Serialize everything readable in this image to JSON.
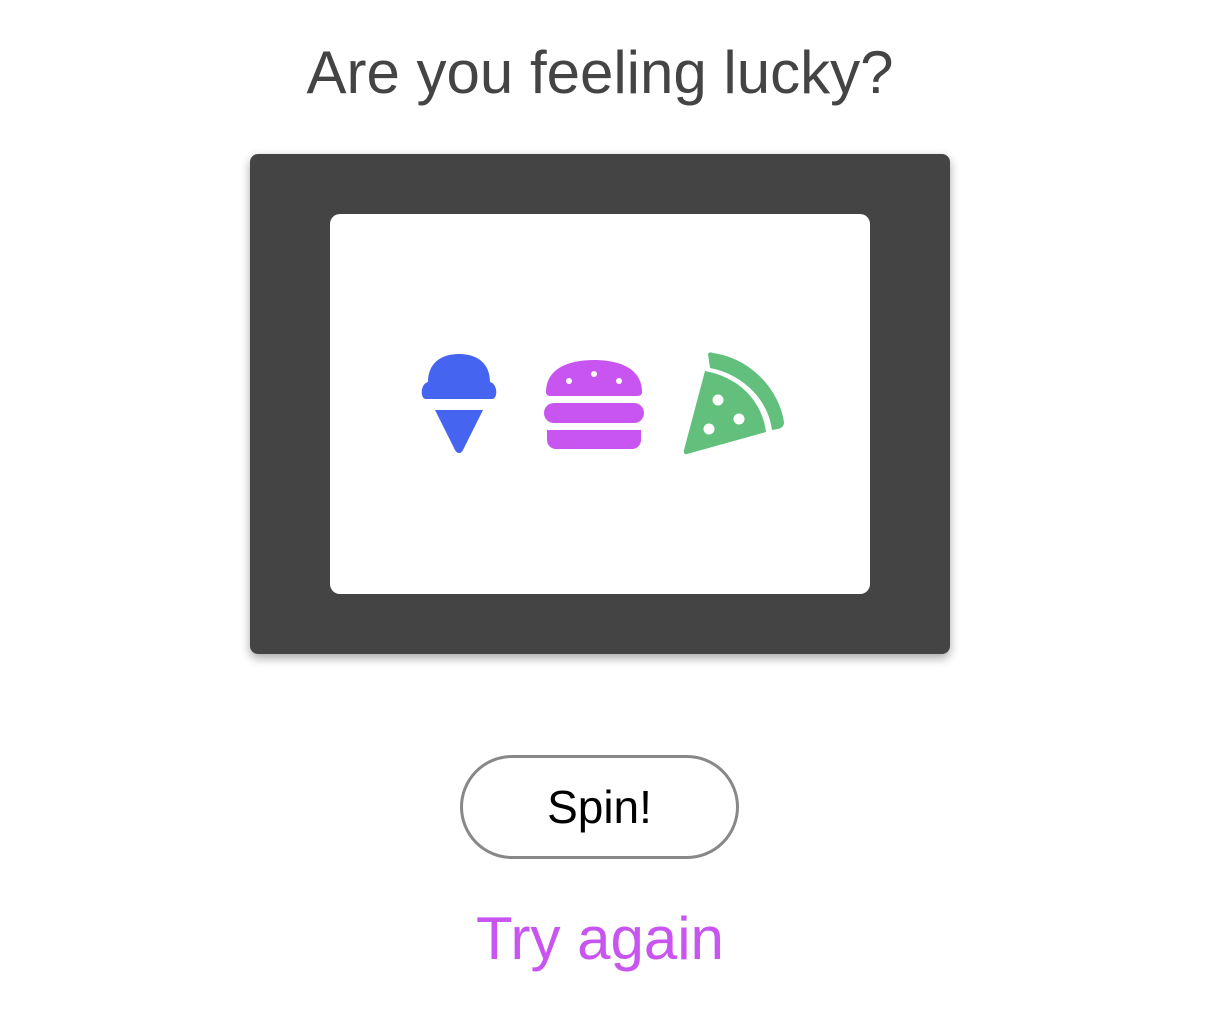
{
  "title": "Are you feeling lucky?",
  "colors": {
    "frame": "#444444",
    "reel_background": "#ffffff",
    "ice_cream": "#4564f0",
    "burger": "#c855ef",
    "pizza": "#62bf7c",
    "result_text": "#c855ef",
    "spin_border": "#888888"
  },
  "reels": [
    {
      "icon": "ice-cream-icon"
    },
    {
      "icon": "burger-icon"
    },
    {
      "icon": "pizza-icon"
    }
  ],
  "spin_button": {
    "label": "Spin!"
  },
  "result": {
    "text": "Try again"
  }
}
